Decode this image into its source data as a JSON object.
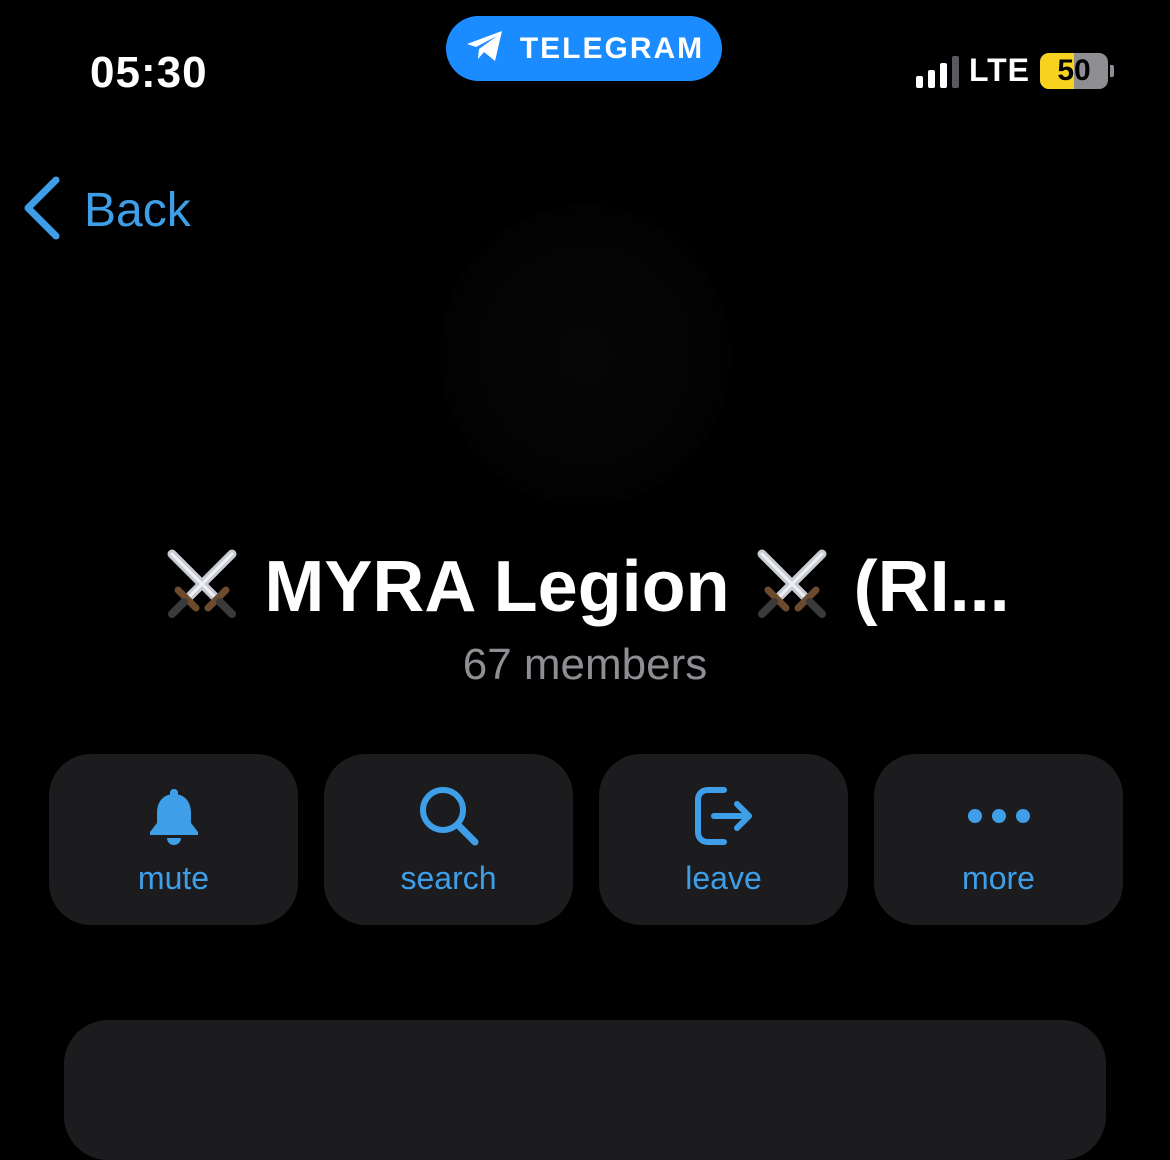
{
  "status_bar": {
    "time": "05:30",
    "network": "LTE",
    "battery_level": "50",
    "battery_fraction": 0.5,
    "signal_bars_active": 3,
    "signal_bars_total": 4
  },
  "return_pill": {
    "label": "TELEGRAM",
    "icon": "telegram-plane-icon",
    "color": "#1a8cff"
  },
  "nav": {
    "back_label": "Back",
    "accent": "#3e9fe8"
  },
  "profile": {
    "title": "MYRA Legion",
    "title_suffix": "(RI...",
    "emoji_left": "⚔️",
    "emoji_right": "⚔️",
    "subtitle": "67 members"
  },
  "actions": [
    {
      "label": "mute",
      "icon": "bell-icon"
    },
    {
      "label": "search",
      "icon": "search-icon"
    },
    {
      "label": "leave",
      "icon": "leave-icon"
    },
    {
      "label": "more",
      "icon": "more-icon"
    }
  ]
}
